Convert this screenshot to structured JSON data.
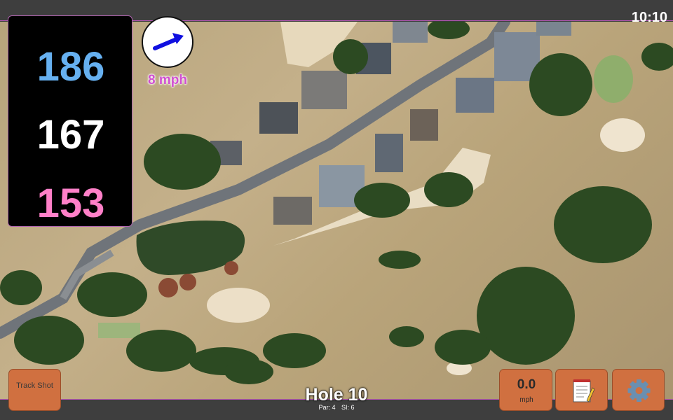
{
  "status_bar": {
    "time": "10:10"
  },
  "yardage": {
    "back": "186",
    "middle": "167",
    "front": "153"
  },
  "wind": {
    "speed_label": "8 mph",
    "direction_icon": "wind-arrow-icon",
    "arrow_color": "#1010e0"
  },
  "buttons": {
    "track_shot": "Track Shot",
    "speed_value": "0.0",
    "speed_unit": "mph",
    "notes_icon": "notepad-icon",
    "settings_icon": "gear-icon"
  },
  "hole": {
    "title": "Hole 10",
    "par_label": "Par: 4",
    "si_label": "SI: 6"
  },
  "colors": {
    "accent_border": "#b055b0",
    "button": "#d07040",
    "back_yardage": "#66b0f0",
    "front_yardage": "#ff80c8"
  }
}
